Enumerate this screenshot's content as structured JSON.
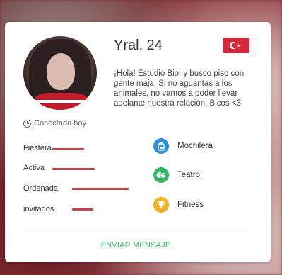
{
  "profile": {
    "title": "Yral, 24",
    "bio": "¡Hola! Estudio Bio, y busco piso con gente maja. Si no aguantas a los animales, no vamos a poder llevar adelante nuestra relación. Bicos <3",
    "flag_glyph": "C★",
    "online_status": "Conectada hoy"
  },
  "traits": [
    {
      "label": "Fiestera",
      "level": 0.45
    },
    {
      "label": "Activa",
      "level": 0.6
    },
    {
      "label": "Ordenada",
      "level": 0.8
    },
    {
      "label": "invitados",
      "level": 0.3
    }
  ],
  "interests": [
    {
      "label": "Mochilera",
      "icon": "backpack-icon",
      "color": "#2f8fd6"
    },
    {
      "label": "Teatro",
      "icon": "theater-masks-icon",
      "color": "#36b763"
    },
    {
      "label": "Fitness",
      "icon": "trophy-icon",
      "color": "#f0b323"
    }
  ],
  "actions": {
    "send_message": "ENVIAR MENSAJE"
  },
  "colors": {
    "accent": "#3cb96a",
    "trait_bar": "#c0454a",
    "flag": "#d6283c"
  }
}
